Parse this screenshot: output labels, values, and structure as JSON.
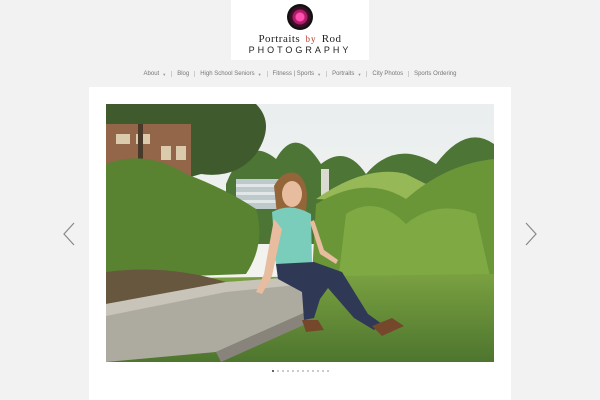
{
  "logo": {
    "line1_a": "Portraits",
    "line1_by": "by",
    "line1_b": "Rod",
    "line2": "PHOTOGRAPHY",
    "lens_icon": "camera-lens-icon"
  },
  "nav": {
    "items": [
      {
        "label": "About",
        "dropdown": true
      },
      {
        "label": "Blog",
        "dropdown": false
      },
      {
        "label": "High School Seniors",
        "dropdown": true
      },
      {
        "label": "Fitness | Sports",
        "dropdown": true
      },
      {
        "label": "Portraits",
        "dropdown": true
      },
      {
        "label": "City Photos",
        "dropdown": false
      },
      {
        "label": "Sports Ordering",
        "dropdown": false
      }
    ]
  },
  "slider": {
    "prev_icon": "chevron-left-icon",
    "next_icon": "chevron-right-icon",
    "slide_count": 12,
    "active_index": 0
  },
  "colors": {
    "background": "#f2f2f2",
    "panel": "#ffffff",
    "logo_accent": "#c0392b"
  }
}
